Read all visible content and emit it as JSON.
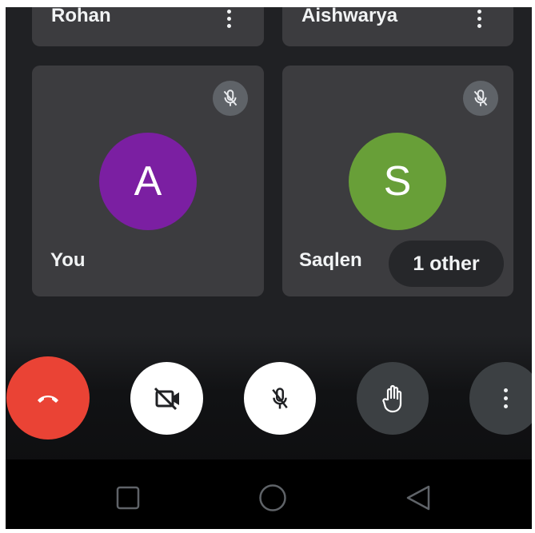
{
  "top_row": {
    "left_name": "Rohan",
    "right_name": "Aishwarya"
  },
  "tiles": [
    {
      "name": "You",
      "initial": "A",
      "avatar_color": "#7b1fa2",
      "muted": true
    },
    {
      "name": "Saqlen",
      "initial": "S",
      "avatar_color": "#689f38",
      "muted": true
    }
  ],
  "others_pill": "1 other",
  "controls": {
    "end_call_color": "#ea4335",
    "buttons": [
      "end-call",
      "camera-off",
      "microphone-off",
      "raise-hand",
      "more-options"
    ]
  },
  "icons": {
    "mute": "mic-off-icon",
    "more": "more-vert-icon",
    "end": "call-end-icon",
    "camera": "videocam-off-icon",
    "hand": "hand-icon",
    "nav": [
      "recent-apps-icon",
      "home-icon",
      "back-icon"
    ]
  }
}
